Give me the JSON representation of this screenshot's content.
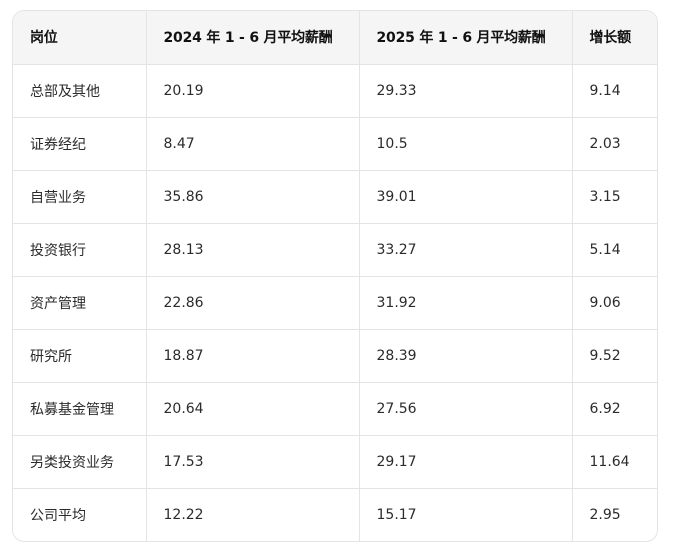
{
  "table": {
    "headers": [
      "岗位",
      "2024 年 1 - 6 月平均薪酬",
      "2025 年 1 - 6 月平均薪酬",
      "增长额"
    ],
    "rows": [
      [
        "总部及其他",
        "20.19",
        "29.33",
        "9.14"
      ],
      [
        "证券经纪",
        "8.47",
        "10.5",
        "2.03"
      ],
      [
        "自营业务",
        "35.86",
        "39.01",
        "3.15"
      ],
      [
        "投资银行",
        "28.13",
        "33.27",
        "5.14"
      ],
      [
        "资产管理",
        "22.86",
        "31.92",
        "9.06"
      ],
      [
        "研究所",
        "18.87",
        "28.39",
        "9.52"
      ],
      [
        "私募基金管理",
        "20.64",
        "27.56",
        "6.92"
      ],
      [
        "另类投资业务",
        "17.53",
        "29.17",
        "11.64"
      ],
      [
        "公司平均",
        "12.22",
        "15.17",
        "2.95"
      ]
    ]
  }
}
